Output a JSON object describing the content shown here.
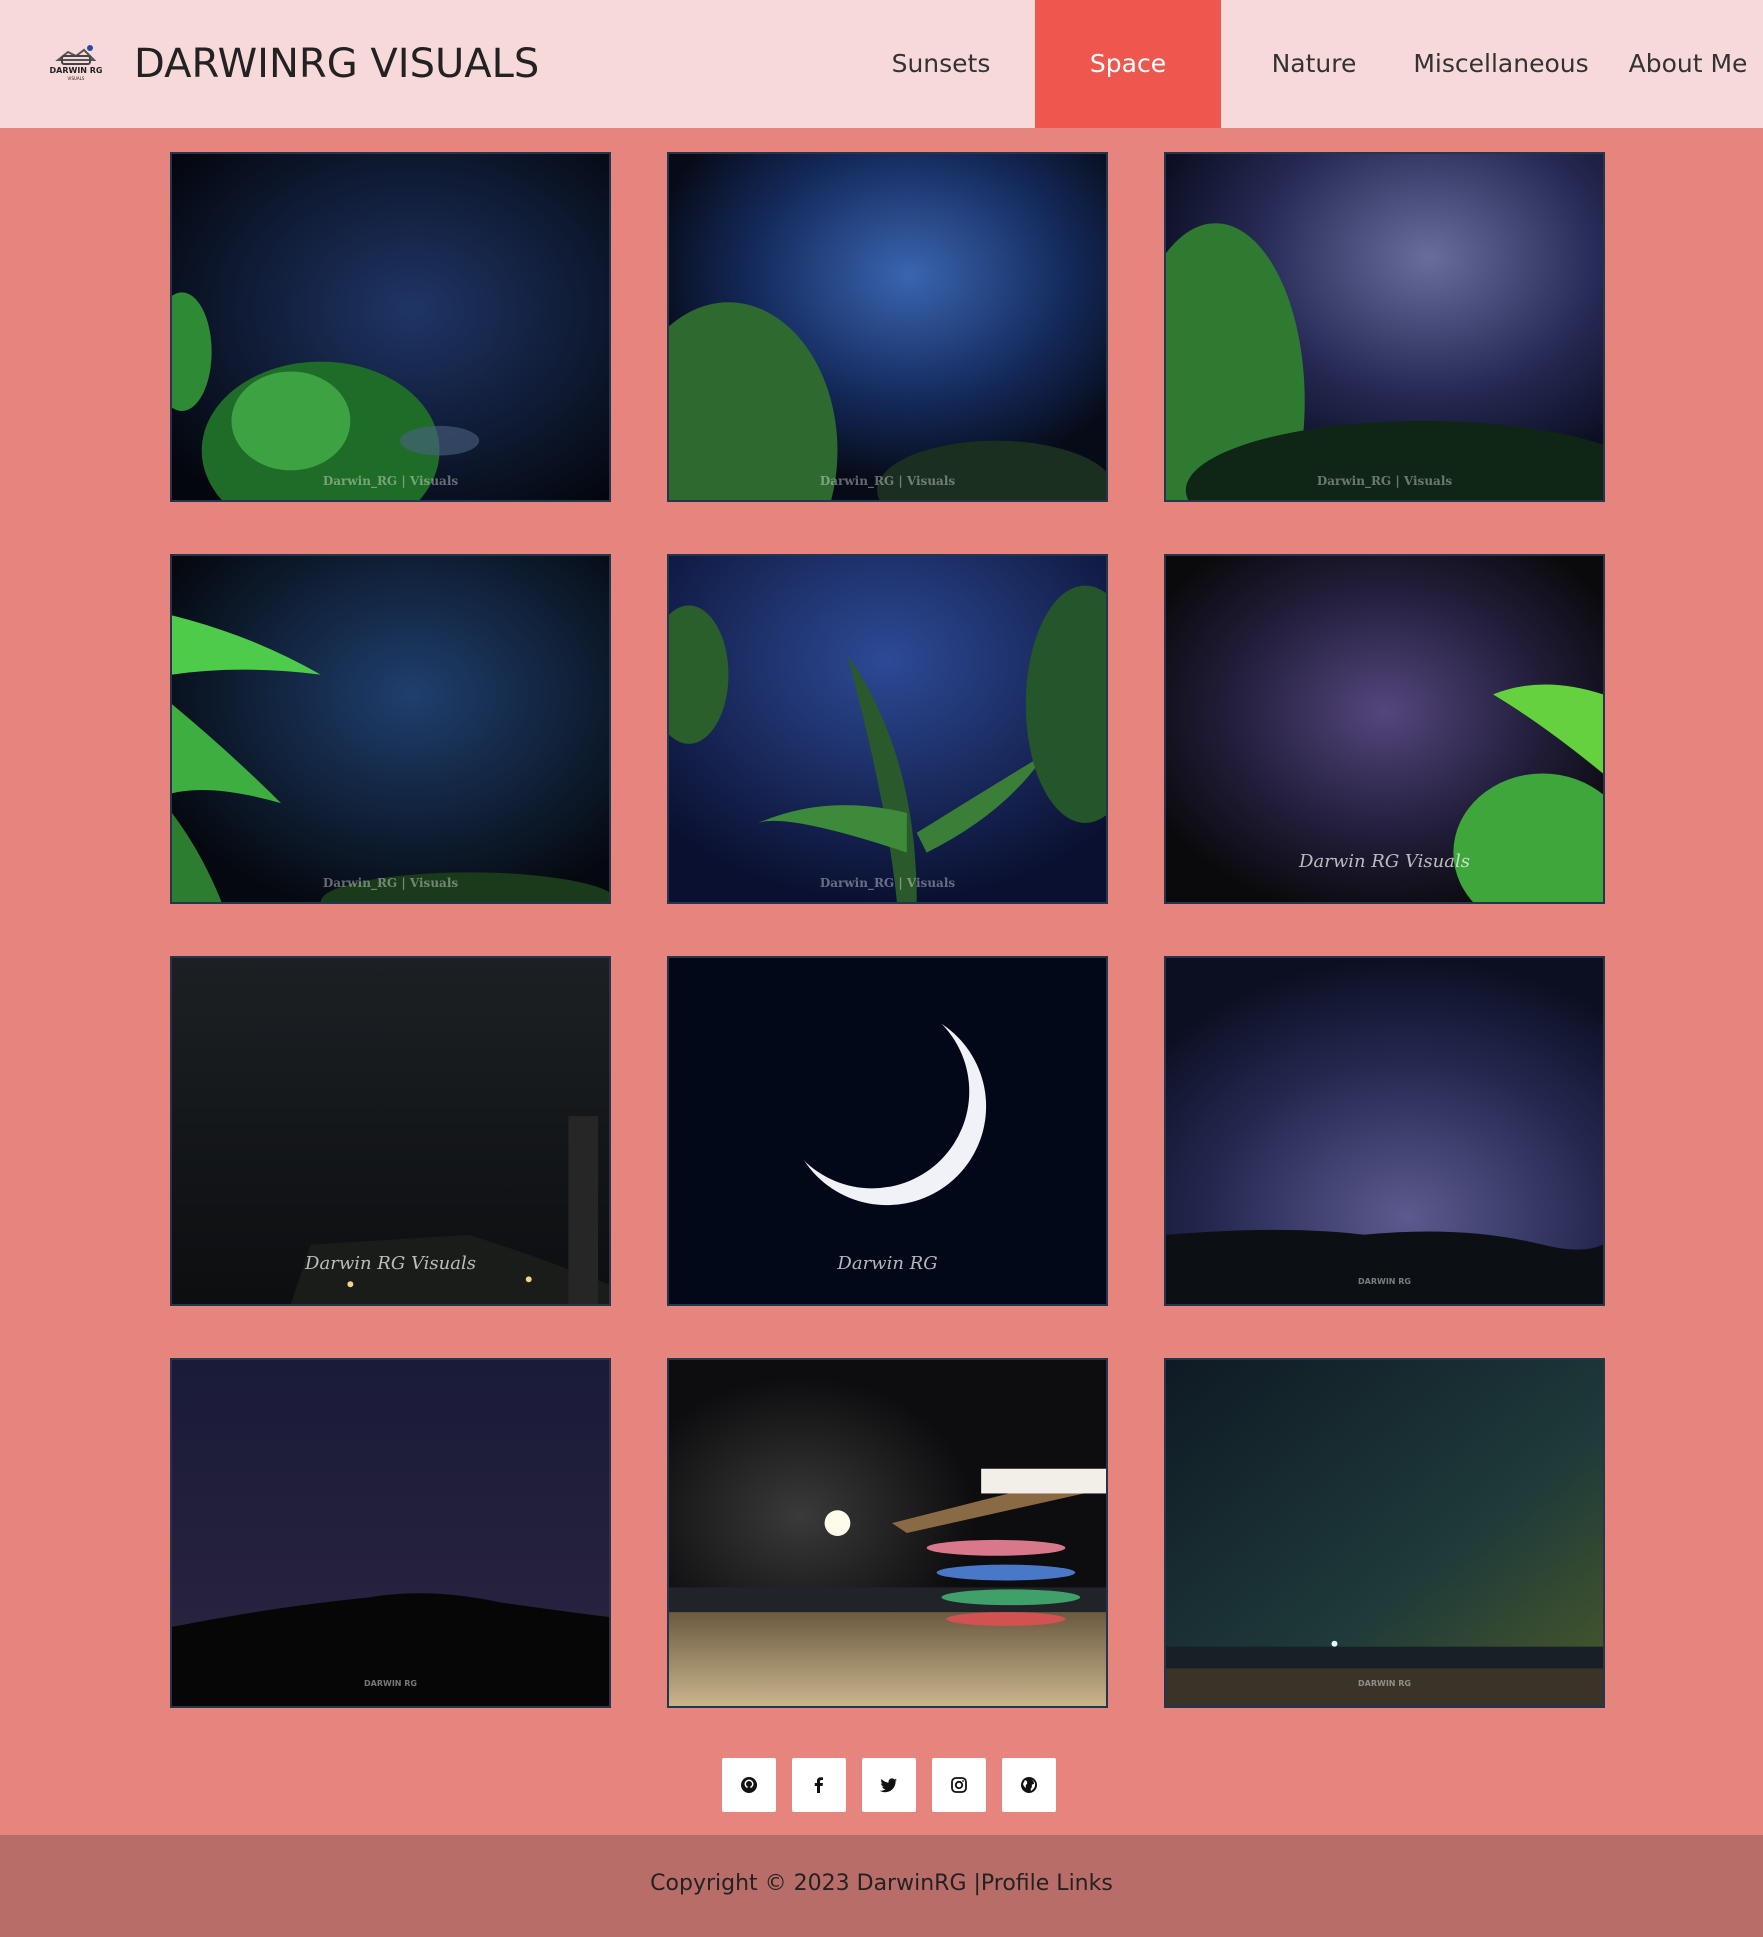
{
  "header": {
    "brand": "DARWINRG VISUALS",
    "logo_text": "DARWIN RG",
    "logo_subtext": "VISUALS"
  },
  "nav": {
    "items": [
      {
        "label": "Sunsets",
        "active": false
      },
      {
        "label": "Space",
        "active": true
      },
      {
        "label": "Nature",
        "active": false
      },
      {
        "label": "Miscellaneous",
        "active": false
      },
      {
        "label": "About Me",
        "active": false
      }
    ]
  },
  "gallery": {
    "photos": [
      {
        "subject": "starry sky with tree",
        "watermark": "Darwin_RG | Visuals"
      },
      {
        "subject": "milky way above trees",
        "watermark": "Darwin_RG | Visuals"
      },
      {
        "subject": "purple milky way over forest",
        "watermark": "Darwin_RG | Visuals"
      },
      {
        "subject": "stars with banana leaves",
        "watermark": "Darwin_RG | Visuals"
      },
      {
        "subject": "banana tree under stars",
        "watermark": "Darwin_RG | Visuals"
      },
      {
        "subject": "purple sky with leaves",
        "watermark": "Darwin RG Visuals"
      },
      {
        "subject": "night sky over rooftops",
        "watermark": "Darwin RG Visuals"
      },
      {
        "subject": "crescent moon",
        "watermark": "Darwin RG"
      },
      {
        "subject": "stars over hills",
        "watermark": "DARWIN RG"
      },
      {
        "subject": "starry sky over hill",
        "watermark": "DARWIN RG"
      },
      {
        "subject": "moon over beach with surfboards",
        "watermark": ""
      },
      {
        "subject": "night sea horizon",
        "watermark": "DARWIN RG"
      }
    ]
  },
  "social": {
    "icons": [
      "github-icon",
      "facebook-icon",
      "twitter-icon",
      "instagram-icon",
      "globe-icon"
    ]
  },
  "footer": {
    "copyright": "Copyright © 2023 DarwinRG |",
    "link": "Profile Links"
  },
  "colors": {
    "background": "#e5857d",
    "header": "#f8d9da",
    "active_nav": "#ed574d",
    "footer": "#b96d68"
  }
}
